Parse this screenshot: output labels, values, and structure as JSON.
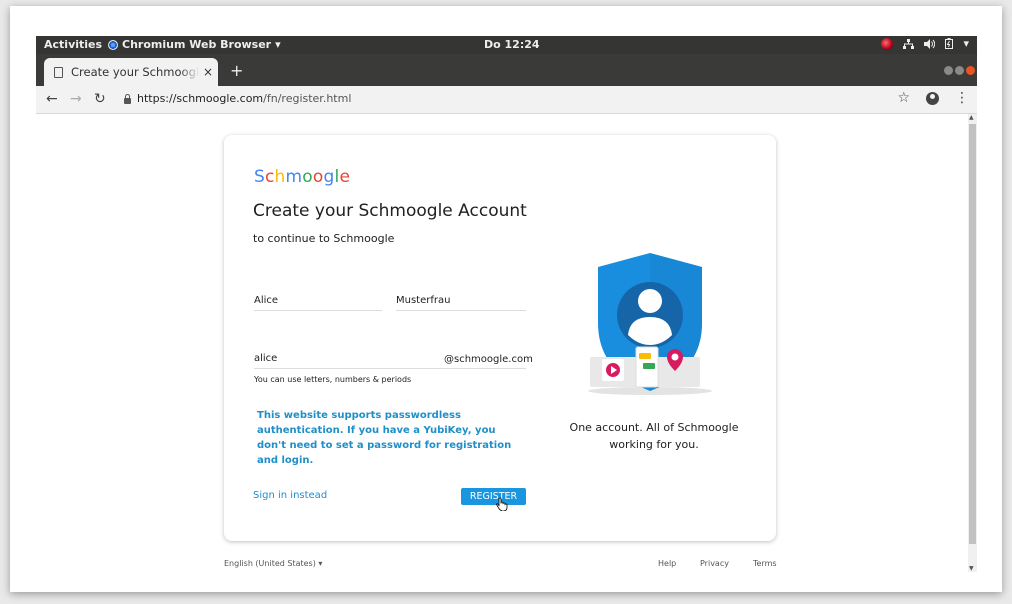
{
  "topbar": {
    "activities": "Activities",
    "app_name": "Chromium Web Browser",
    "app_menu_arrow": "▾",
    "clock": "Do 12:24"
  },
  "tab": {
    "title": "Create your Schmoogle Account",
    "close": "×",
    "new_tab": "+"
  },
  "addressbar": {
    "back": "←",
    "forward": "→",
    "reload": "↻",
    "url_host": "https://schmoogle.com",
    "url_path": "/fn/register.html",
    "bookmark": "☆",
    "menu": "⋮"
  },
  "card": {
    "logo_letters": [
      "S",
      "c",
      "h",
      "m",
      "o",
      "o",
      "g",
      "l",
      "e"
    ],
    "headline": "Create your Schmoogle Account",
    "subhead": "to continue to Schmoogle",
    "first_name": "Alice",
    "last_name": "Musterfrau",
    "username": "alice",
    "username_suffix": "@schmoogle.com",
    "username_hint": "You can use letters, numbers & periods",
    "notice": "This website supports passwordless authentication. If you have a YubiKey, you don't need to set a password for registration and login.",
    "signin_link": "Sign in instead",
    "register_button": "REGISTER",
    "tagline_line1": "One account. All of Schmoogle",
    "tagline_line2": "working for you."
  },
  "footer": {
    "language": "English (United States)",
    "language_arrow": "▾",
    "help": "Help",
    "privacy": "Privacy",
    "terms": "Terms"
  },
  "colors": {
    "accent": "#1a95e0",
    "shield": "#1a8ede",
    "topbar": "#353533"
  }
}
